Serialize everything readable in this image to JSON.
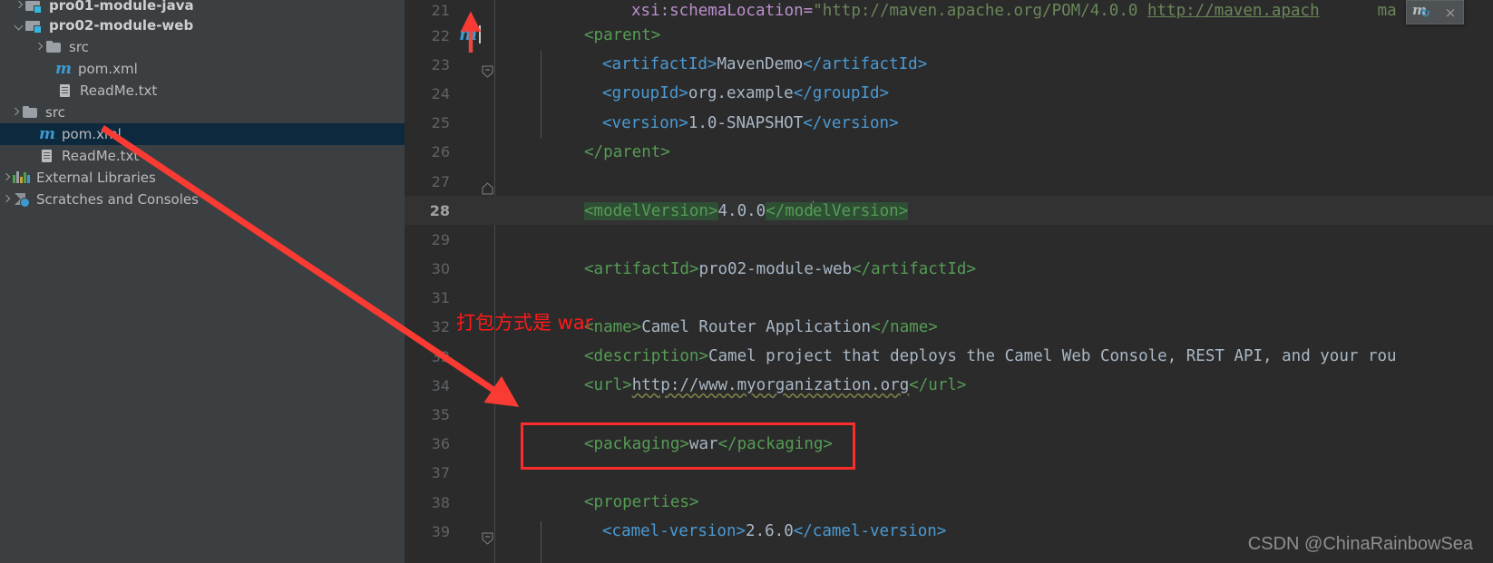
{
  "sidebar": {
    "items": [
      {
        "label": "pro01-module-java",
        "icon": "module-folder-icon",
        "arrow": "right",
        "indent": 0,
        "bold": true,
        "selected": false,
        "clipped": true
      },
      {
        "label": "pro02-module-web",
        "icon": "module-folder-icon",
        "arrow": "down",
        "indent": 0,
        "bold": true,
        "selected": false
      },
      {
        "label": "src",
        "icon": "folder-icon",
        "arrow": "right",
        "indent": 1,
        "bold": false,
        "selected": false
      },
      {
        "label": "pom.xml",
        "icon": "maven-file-icon",
        "arrow": "none",
        "indent": 2,
        "bold": false,
        "selected": false
      },
      {
        "label": "ReadMe.txt",
        "icon": "text-file-icon",
        "arrow": "none",
        "indent": 2,
        "bold": false,
        "selected": false
      },
      {
        "label": "src",
        "icon": "folder-icon",
        "arrow": "right",
        "indent": 0,
        "bold": false,
        "selected": false
      },
      {
        "label": "pom.xml",
        "icon": "maven-file-icon",
        "arrow": "none",
        "indent": 1,
        "bold": false,
        "selected": true
      },
      {
        "label": "ReadMe.txt",
        "icon": "text-file-icon",
        "arrow": "none",
        "indent": 1,
        "bold": false,
        "selected": false
      },
      {
        "label": "External Libraries",
        "icon": "libraries-icon",
        "arrow": "right",
        "indent": -1,
        "bold": false,
        "selected": false
      },
      {
        "label": "Scratches and Consoles",
        "icon": "scratches-icon",
        "arrow": "right",
        "indent": -1,
        "bold": false,
        "selected": false
      }
    ]
  },
  "editor": {
    "current_line": 28,
    "lines": [
      {
        "num": "21",
        "kind": "schema"
      },
      {
        "num": "22",
        "kind": "parent-open"
      },
      {
        "num": "23",
        "kind": "artifactid-mavendemo"
      },
      {
        "num": "24",
        "kind": "groupid"
      },
      {
        "num": "25",
        "kind": "version"
      },
      {
        "num": "26",
        "kind": "parent-close"
      },
      {
        "num": "27",
        "kind": "blank"
      },
      {
        "num": "28",
        "kind": "modelversion"
      },
      {
        "num": "29",
        "kind": "blank"
      },
      {
        "num": "30",
        "kind": "artifactid-web"
      },
      {
        "num": "31",
        "kind": "blank"
      },
      {
        "num": "32",
        "kind": "name"
      },
      {
        "num": "33",
        "kind": "description"
      },
      {
        "num": "34",
        "kind": "url"
      },
      {
        "num": "35",
        "kind": "blank"
      },
      {
        "num": "36",
        "kind": "packaging"
      },
      {
        "num": "37",
        "kind": "blank"
      },
      {
        "num": "38",
        "kind": "properties-open"
      },
      {
        "num": "39",
        "kind": "camel-version"
      }
    ],
    "code": {
      "l21_attr": "xsi:schemaLocation=",
      "l21_quote": "\"",
      "l21_url1": "http://maven.apache.org/POM/4.0.0",
      "l21_space": " ",
      "l21_url2": "http://maven.apach",
      "l21_tail": "ma",
      "l22": "<parent>",
      "l23_open": "<artifactId>",
      "l23_val": "MavenDemo",
      "l23_close": "</artifactId>",
      "l24_open": "<groupId>",
      "l24_val": "org.example",
      "l24_close": "</groupId>",
      "l25_open": "<version>",
      "l25_val": "1.0-SNAPSHOT",
      "l25_close": "</version>",
      "l26": "</parent>",
      "l28_open": "<modelVersion>",
      "l28_val": "4.0.0",
      "l28_close_a": "</mod",
      "l28_close_b": "elVersion>",
      "l30_open": "<artifactId>",
      "l30_val": "pro02-module-web",
      "l30_close": "</artifactId>",
      "l32_open": "<name>",
      "l32_val": "Camel Router Application",
      "l32_close": "</name>",
      "l33_open": "<description>",
      "l33_val": "Camel project that deploys the Camel Web Console, REST API, and your rou",
      "l34_open": "<url>",
      "l34_val": "http://www.myorganization.org",
      "l34_close": "</url>",
      "l36_open": "<packaging>",
      "l36_val": "war",
      "l36_close": "</packaging>",
      "l38": "<properties>",
      "l39_open": "<camel-version>",
      "l39_val": "2.6.0",
      "l39_close": "</camel-version>"
    }
  },
  "maven_popup": {
    "letter": "m",
    "refresh_glyph": "↻",
    "close_glyph": "×"
  },
  "annotations": {
    "chinese_note": "打包方式是 war",
    "highlight_color": "#fb2c2c",
    "arrow_color": "#f93b33"
  },
  "watermark": {
    "text": "CSDN @ChinaRainbowSea"
  }
}
